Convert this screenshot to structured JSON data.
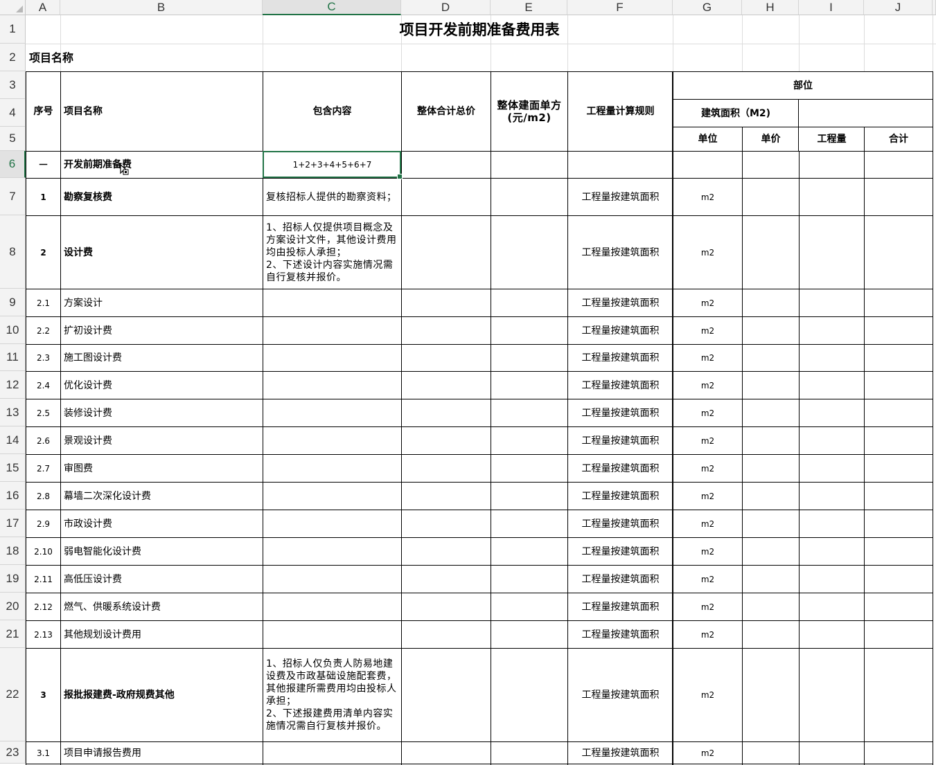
{
  "columns": [
    "A",
    "B",
    "C",
    "D",
    "E",
    "F",
    "G",
    "H",
    "I",
    "J"
  ],
  "selected_column": "C",
  "selected_row": "6",
  "rows": [
    "1",
    "2",
    "3",
    "4",
    "5",
    "6",
    "7",
    "8",
    "9",
    "10",
    "11",
    "12",
    "13",
    "14",
    "15",
    "16",
    "17",
    "18",
    "19",
    "20",
    "21",
    "22",
    "23"
  ],
  "sheet": {
    "title": "项目开发前期准备费用表",
    "project_name_label": "项目名称"
  },
  "header": {
    "seq": "序号",
    "item_name": "项目名称",
    "content": "包含内容",
    "total_price": "整体合计总价",
    "unit_price_area": "整体建面单方(元/m2)",
    "quantity_rule": "工程量计算规则",
    "part": "部位",
    "building_area": "建筑面积（M2)",
    "unit": "单位",
    "price": "单价",
    "quantity": "工程量",
    "sum": "合计"
  },
  "items": [
    {
      "seq": "一",
      "name": "开发前期准备费",
      "content": "1+2+3+4+5+6+7",
      "rule": "",
      "unit": ""
    },
    {
      "seq": "1",
      "name": "勘察复核费",
      "content": "复核招标人提供的勘察资料；",
      "rule": "工程量按建筑面积",
      "unit": "m2"
    },
    {
      "seq": "2",
      "name": "设计费",
      "content": "1、招标人仅提供项目概念及方案设计文件，其他设计费用均由投标人承担；\n2、下述设计内容实施情况需自行复核并报价。",
      "rule": "工程量按建筑面积",
      "unit": "m2"
    },
    {
      "seq": "2.1",
      "name": "方案设计",
      "content": "",
      "rule": "工程量按建筑面积",
      "unit": "m2"
    },
    {
      "seq": "2.2",
      "name": "扩初设计费",
      "content": "",
      "rule": "工程量按建筑面积",
      "unit": "m2"
    },
    {
      "seq": "2.3",
      "name": "施工图设计费",
      "content": "",
      "rule": "工程量按建筑面积",
      "unit": "m2"
    },
    {
      "seq": "2.4",
      "name": "优化设计费",
      "content": "",
      "rule": "工程量按建筑面积",
      "unit": "m2"
    },
    {
      "seq": "2.5",
      "name": "装修设计费",
      "content": "",
      "rule": "工程量按建筑面积",
      "unit": "m2"
    },
    {
      "seq": "2.6",
      "name": "景观设计费",
      "content": "",
      "rule": "工程量按建筑面积",
      "unit": "m2"
    },
    {
      "seq": "2.7",
      "name": "审图费",
      "content": "",
      "rule": "工程量按建筑面积",
      "unit": "m2"
    },
    {
      "seq": "2.8",
      "name": "幕墙二次深化设计费",
      "content": "",
      "rule": "工程量按建筑面积",
      "unit": "m2"
    },
    {
      "seq": "2.9",
      "name": "市政设计费",
      "content": "",
      "rule": "工程量按建筑面积",
      "unit": "m2"
    },
    {
      "seq": "2.10",
      "name": "弱电智能化设计费",
      "content": "",
      "rule": "工程量按建筑面积",
      "unit": "m2"
    },
    {
      "seq": "2.11",
      "name": "高低压设计费",
      "content": "",
      "rule": "工程量按建筑面积",
      "unit": "m2"
    },
    {
      "seq": "2.12",
      "name": "燃气、供暖系统设计费",
      "content": "",
      "rule": "工程量按建筑面积",
      "unit": "m2"
    },
    {
      "seq": "2.13",
      "name": "其他规划设计费用",
      "content": "",
      "rule": "工程量按建筑面积",
      "unit": "m2"
    },
    {
      "seq": "3",
      "name": "报批报建费-政府规费其他",
      "content": "1、招标人仅负责人防易地建设费及市政基础设施配套费，其他报建所需费用均由投标人承担；\n2、下述报建费用清单内容实施情况需自行复核并报价。",
      "rule": "工程量按建筑面积",
      "unit": "m2"
    },
    {
      "seq": "3.1",
      "name": "项目申请报告费用",
      "content": "",
      "rule": "工程量按建筑面积",
      "unit": "m2"
    }
  ]
}
